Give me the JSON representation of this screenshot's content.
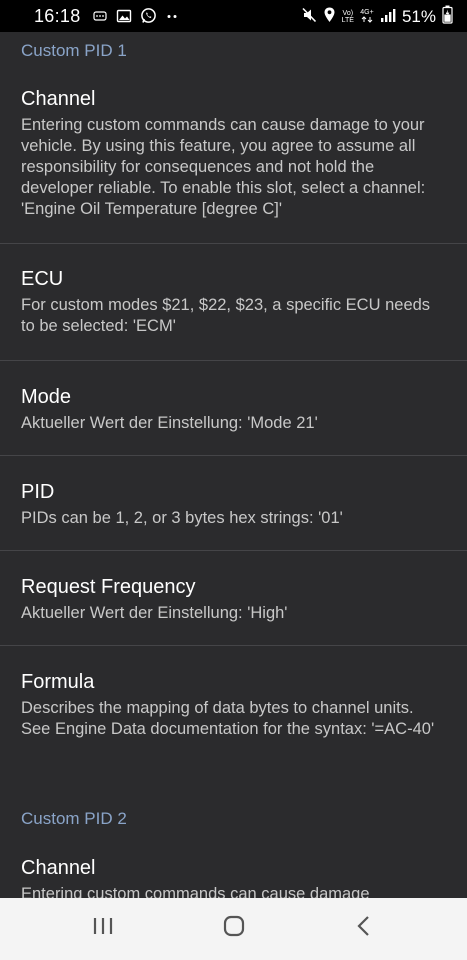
{
  "status_bar": {
    "time": "16:18",
    "battery": "51%",
    "volte_top": "Vo)",
    "volte_bottom": "LTE",
    "network": "4G+",
    "left_icons": [
      "obd-icon",
      "image-icon",
      "whatsapp-icon",
      "more-dots-icon"
    ],
    "right_icons": [
      "mute-icon",
      "location-icon",
      "volte-icon",
      "network-icon",
      "signal-icon",
      "battery-icon"
    ]
  },
  "sections": [
    {
      "header": "Custom PID 1",
      "items": [
        {
          "title": "Channel",
          "summary": "Entering custom commands can cause damage to your vehicle. By using this feature, you agree to assume all responsibility for consequences and not hold the developer reliable. To enable this slot, select a channel: 'Engine Oil Temperature [degree C]'"
        },
        {
          "title": "ECU",
          "summary": "For custom modes $21, $22, $23, a specific ECU needs to be selected: 'ECM'"
        },
        {
          "title": "Mode",
          "summary": "Aktueller Wert der Einstellung: 'Mode 21'"
        },
        {
          "title": "PID",
          "summary": "PIDs can be 1, 2, or 3 bytes hex strings: '01'"
        },
        {
          "title": "Request Frequency",
          "summary": "Aktueller Wert der Einstellung: 'High'"
        },
        {
          "title": "Formula",
          "summary": "Describes the mapping of data bytes to channel units. See Engine Data documentation for the syntax: '=AC-40'"
        }
      ]
    },
    {
      "header": "Custom PID 2",
      "items": [
        {
          "title": "Channel",
          "summary": "Entering custom commands can cause damage"
        }
      ]
    }
  ],
  "nav_bar": {
    "buttons": [
      "recent-apps-icon",
      "home-icon",
      "back-icon"
    ]
  },
  "colors": {
    "background": "#2b2b2d",
    "section_header": "#8aa4c8",
    "title": "#ffffff",
    "summary": "#c8c8c8",
    "divider": "#454548",
    "nav_bar": "#f4f4f4"
  }
}
